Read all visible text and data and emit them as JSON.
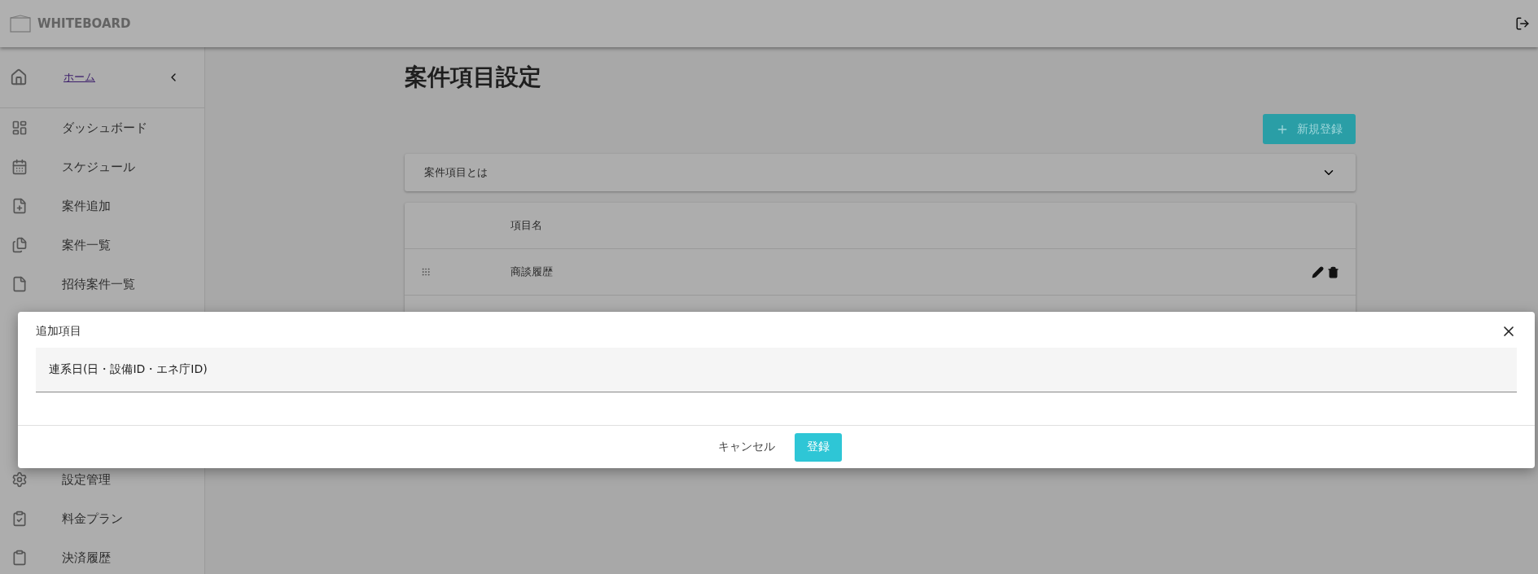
{
  "header": {
    "logo": "WHITEBOARD"
  },
  "sidebar": {
    "home": {
      "label": "ホーム"
    },
    "items_top": [
      {
        "label": "ダッシュボード"
      },
      {
        "label": "スケジュール"
      },
      {
        "label": "案件追加"
      },
      {
        "label": "案件一覧"
      },
      {
        "label": "招待案件一覧"
      }
    ],
    "items_bottom": [
      {
        "label": "設定管理"
      },
      {
        "label": "料金プラン"
      },
      {
        "label": "決済履歴"
      }
    ]
  },
  "page": {
    "title": "案件項目設定",
    "new_button": "新規登録",
    "accordion": {
      "label": "案件項目とは",
      "expanded": false
    },
    "table": {
      "columns": [
        "項目名"
      ],
      "rows": [
        {
          "name": "商談履歴"
        }
      ]
    }
  },
  "dialog": {
    "title": "追加項目",
    "field": {
      "value": "連系日(日・設備ID・エネ庁ID)"
    },
    "cancel": "キャンセル",
    "submit": "登録"
  }
}
